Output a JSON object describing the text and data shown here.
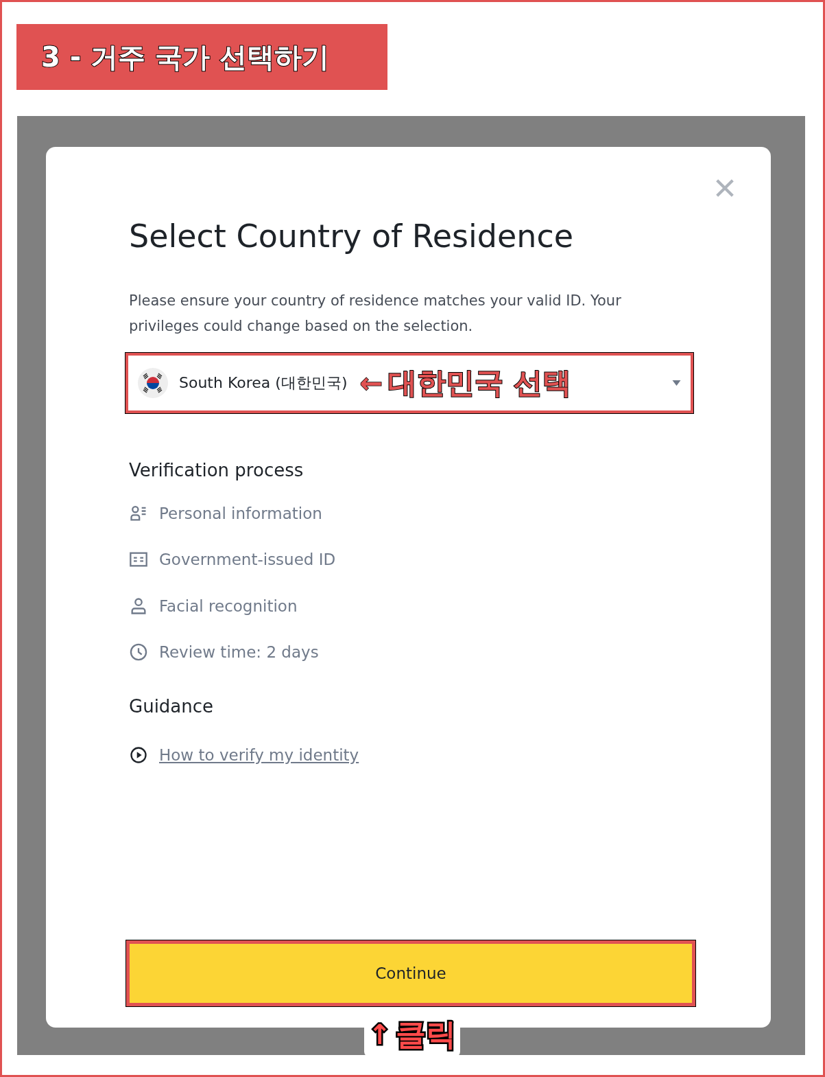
{
  "banner": {
    "title": "3 - 거주 국가 선택하기"
  },
  "modal": {
    "title": "Select Country of Residence",
    "description": "Please ensure your country of residence matches your valid ID. Your privileges could change based on the selection.",
    "country_select": {
      "value": "South Korea (대한민국)",
      "annotation_arrow": "←",
      "annotation": "대한민국 선택"
    },
    "verification": {
      "heading": "Verification process",
      "steps": [
        {
          "kind": "personal",
          "label": "Personal information"
        },
        {
          "kind": "id",
          "label": "Government-issued ID"
        },
        {
          "kind": "face",
          "label": "Facial recognition"
        },
        {
          "kind": "time",
          "label": "Review time: 2 days"
        }
      ]
    },
    "guidance": {
      "heading": "Guidance",
      "link": "How to verify my identity"
    },
    "continue_button": "Continue",
    "click_annotation": {
      "arrow": "↑",
      "text": "클릭"
    }
  }
}
